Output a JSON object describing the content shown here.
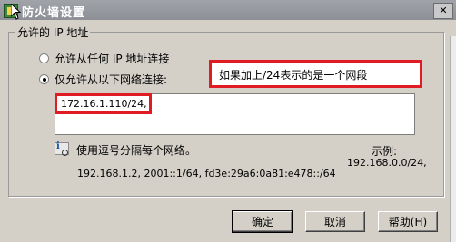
{
  "window": {
    "title": "防火墙设置",
    "close_glyph": "✕"
  },
  "group": {
    "legend": "允许的 IP 地址",
    "radio_any": "允许从任何 IP 地址连接",
    "radio_list": "仅允许从以下网络连接:",
    "selected": "radio_list"
  },
  "networks_field": {
    "value": "172.16.1.110/24,"
  },
  "annotation": {
    "note": "如果加上/24表示的是一个网段"
  },
  "hint": {
    "text": "使用逗号分隔每个网络。",
    "example_label": "示例:",
    "example_value": "192.168.0.0/24,",
    "example_list": "192.168.1.2, 2001::1/64, fd3e:29a6:0a81:e478::/64"
  },
  "buttons": {
    "ok": "确定",
    "cancel": "取消",
    "help": "帮助(H)"
  },
  "colors": {
    "annotation_red": "#e01b24",
    "dialog_bg": "#d4d0c8",
    "titlebar": "#8d9096"
  },
  "icons": {
    "app": "firewall-shield-icon",
    "hint": "info-magnifier-icon"
  }
}
